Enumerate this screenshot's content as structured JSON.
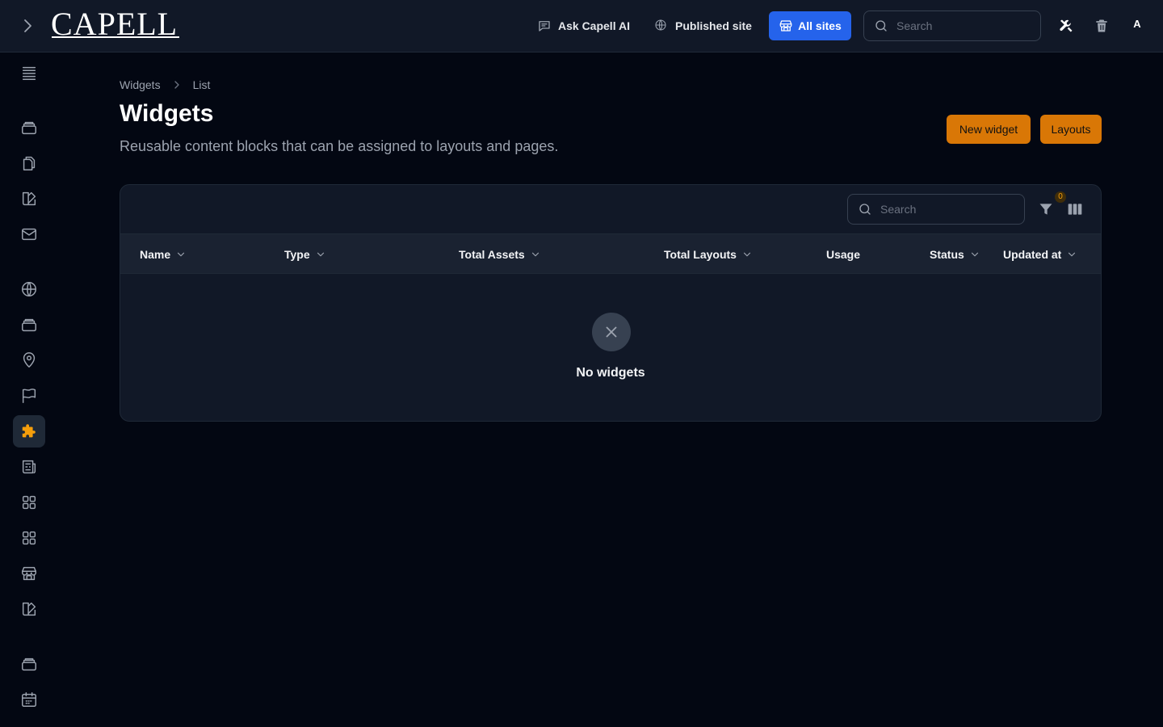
{
  "topbar": {
    "logo": "CAPELL",
    "ask_ai": "Ask Capell AI",
    "published_site": "Published site",
    "all_sites": "All sites",
    "search_placeholder": "Search",
    "avatar_initial": "A"
  },
  "breadcrumb": {
    "items": [
      "Widgets",
      "List"
    ]
  },
  "page": {
    "title": "Widgets",
    "description": "Reusable content blocks that can be assigned to layouts and pages.",
    "new_widget": "New widget",
    "layouts": "Layouts"
  },
  "table": {
    "search_placeholder": "Search",
    "filter_count": "0",
    "columns": [
      "Name",
      "Type",
      "Total Assets",
      "Total Layouts",
      "Usage",
      "Status",
      "Updated at"
    ],
    "empty_text": "No widgets"
  },
  "colors": {
    "accent_orange": "#d97706",
    "primary_blue": "#2563eb",
    "active_icon": "#f59e0b",
    "background": "#030712",
    "surface": "#111827"
  },
  "sidebar": {
    "icons": [
      "list-icon",
      "stack-icon",
      "documents-icon",
      "swatch-icon",
      "mail-icon",
      "globe-icon",
      "stack-icon",
      "map-pin-icon",
      "flag-icon",
      "puzzle-icon",
      "newspaper-icon",
      "grid-icon",
      "grid-icon",
      "storefront-icon",
      "swatch-icon",
      "stack-icon",
      "calendar-icon"
    ],
    "active": "puzzle-icon"
  }
}
